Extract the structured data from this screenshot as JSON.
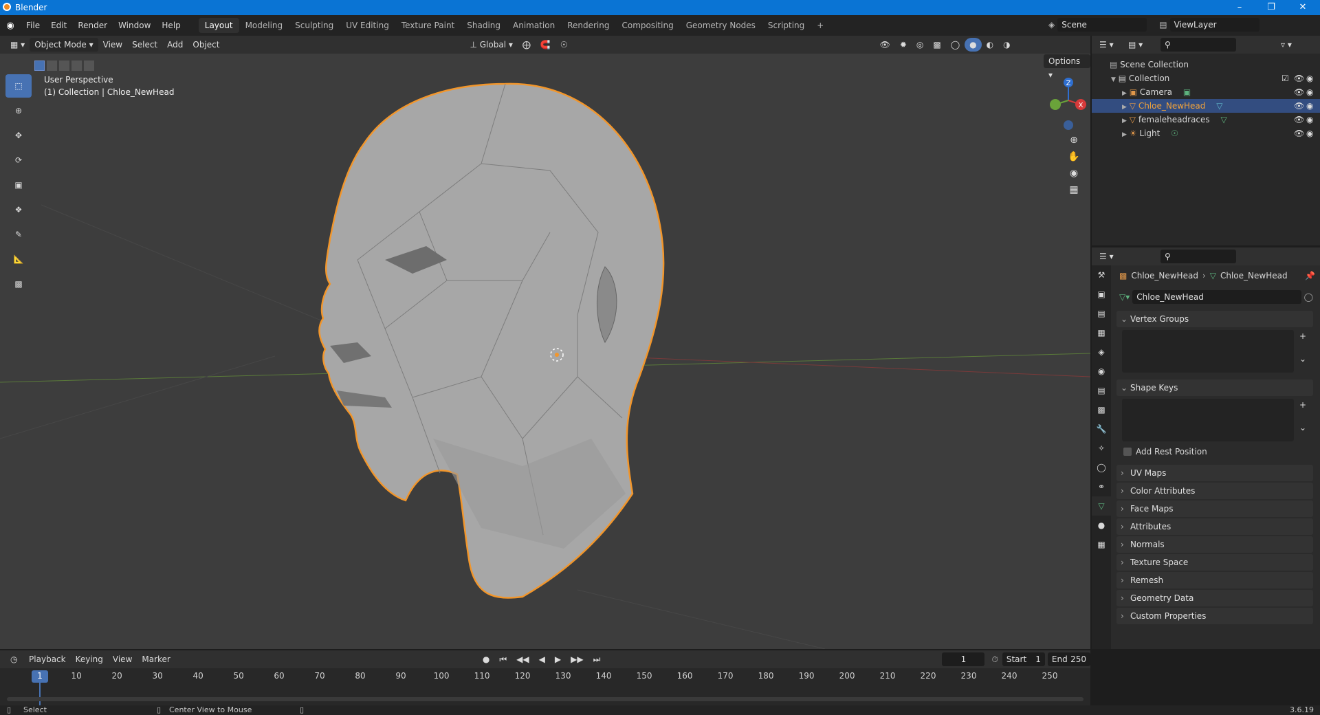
{
  "window": {
    "title": "Blender"
  },
  "menu": {
    "file": "File",
    "edit": "Edit",
    "render": "Render",
    "window": "Window",
    "help": "Help"
  },
  "workspaces": [
    "Layout",
    "Modeling",
    "Sculpting",
    "UV Editing",
    "Texture Paint",
    "Shading",
    "Animation",
    "Rendering",
    "Compositing",
    "Geometry Nodes",
    "Scripting",
    "+"
  ],
  "scene": {
    "name": "Scene",
    "view_layer": "ViewLayer"
  },
  "viewport_header": {
    "mode": "Object Mode",
    "view": "View",
    "select": "Select",
    "add": "Add",
    "object": "Object",
    "orientation": "Global",
    "options": "Options"
  },
  "viewport": {
    "perspective": "User Perspective",
    "collection_info": "(1) Collection | Chloe_NewHead",
    "gizmo_z": "Z",
    "gizmo_x": "X"
  },
  "outliner": {
    "rows": [
      {
        "label": "Scene Collection"
      },
      {
        "label": "Collection"
      },
      {
        "label": "Camera"
      },
      {
        "label": "Chloe_NewHead"
      },
      {
        "label": "femaleheadraces"
      },
      {
        "label": "Light"
      }
    ]
  },
  "properties": {
    "breadcrumb_object": "Chloe_NewHead",
    "breadcrumb_data": "Chloe_NewHead",
    "mesh_name": "Chloe_NewHead",
    "panels": {
      "vertex_groups": "Vertex Groups",
      "shape_keys": "Shape Keys",
      "add_rest_position": "Add Rest Position",
      "uv_maps": "UV Maps",
      "color_attributes": "Color Attributes",
      "face_maps": "Face Maps",
      "attributes": "Attributes",
      "normals": "Normals",
      "texture_space": "Texture Space",
      "remesh": "Remesh",
      "geometry_data": "Geometry Data",
      "custom_properties": "Custom Properties"
    }
  },
  "timeline": {
    "playback": "Playback",
    "keying": "Keying",
    "view": "View",
    "marker": "Marker",
    "current_frame": "1",
    "start_label": "Start",
    "start": "1",
    "end_label": "End",
    "end": "250",
    "ticks": [
      "1",
      "10",
      "20",
      "30",
      "40",
      "50",
      "60",
      "70",
      "80",
      "90",
      "100",
      "110",
      "120",
      "130",
      "140",
      "150",
      "160",
      "170",
      "180",
      "190",
      "200",
      "210",
      "220",
      "230",
      "240",
      "250"
    ]
  },
  "statusbar": {
    "select": "Select",
    "center_view": "Center View to Mouse",
    "version": "3.6.19"
  },
  "colors": {
    "accent": "#4772b3",
    "selection_outline": "#f2962b",
    "title_bar": "#0a74d4"
  }
}
